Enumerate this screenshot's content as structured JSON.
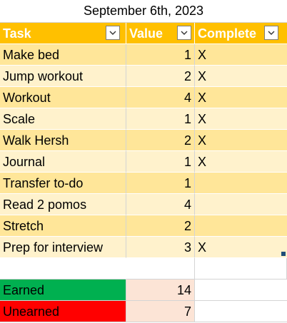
{
  "title": "September 6th, 2023",
  "headers": {
    "task": "Task",
    "value": "Value",
    "complete": "Complete"
  },
  "rows": [
    {
      "task": "Make bed",
      "value": "1",
      "complete": "X"
    },
    {
      "task": "Jump workout",
      "value": "2",
      "complete": "X"
    },
    {
      "task": "Workout",
      "value": "4",
      "complete": "X"
    },
    {
      "task": "Scale",
      "value": "1",
      "complete": "X"
    },
    {
      "task": "Walk Hersh",
      "value": "2",
      "complete": "X"
    },
    {
      "task": "Journal",
      "value": "1",
      "complete": "X"
    },
    {
      "task": "Transfer to-do",
      "value": "1",
      "complete": ""
    },
    {
      "task": "Read 2 pomos",
      "value": "4",
      "complete": ""
    },
    {
      "task": "Stretch",
      "value": "2",
      "complete": ""
    },
    {
      "task": "Prep for interview",
      "value": "3",
      "complete": "X"
    }
  ],
  "summary": {
    "earned_label": "Earned",
    "earned_value": "14",
    "unearned_label": "Unearned",
    "unearned_value": "7"
  },
  "icons": {
    "filter": "filter-dropdown-icon"
  },
  "colors": {
    "header": "#ffc000",
    "band_dark": "#ffe699",
    "band_light": "#fff2cc",
    "earned": "#00b050",
    "unearned": "#ff0000",
    "sum_value": "#fce4d6"
  }
}
